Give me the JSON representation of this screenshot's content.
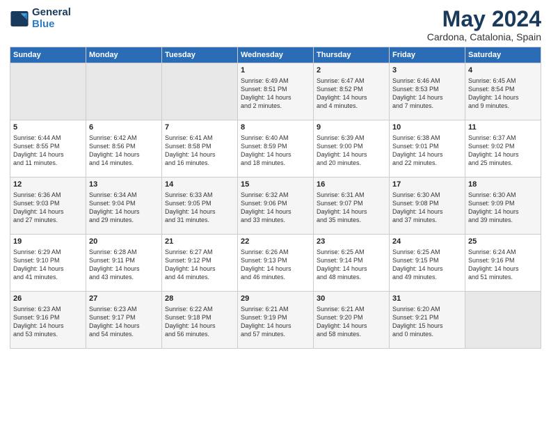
{
  "logo": {
    "line1": "General",
    "line2": "Blue"
  },
  "header": {
    "month_year": "May 2024",
    "location": "Cardona, Catalonia, Spain"
  },
  "weekdays": [
    "Sunday",
    "Monday",
    "Tuesday",
    "Wednesday",
    "Thursday",
    "Friday",
    "Saturday"
  ],
  "weeks": [
    [
      {
        "day": "",
        "content": ""
      },
      {
        "day": "",
        "content": ""
      },
      {
        "day": "",
        "content": ""
      },
      {
        "day": "1",
        "content": "Sunrise: 6:49 AM\nSunset: 8:51 PM\nDaylight: 14 hours\nand 2 minutes."
      },
      {
        "day": "2",
        "content": "Sunrise: 6:47 AM\nSunset: 8:52 PM\nDaylight: 14 hours\nand 4 minutes."
      },
      {
        "day": "3",
        "content": "Sunrise: 6:46 AM\nSunset: 8:53 PM\nDaylight: 14 hours\nand 7 minutes."
      },
      {
        "day": "4",
        "content": "Sunrise: 6:45 AM\nSunset: 8:54 PM\nDaylight: 14 hours\nand 9 minutes."
      }
    ],
    [
      {
        "day": "5",
        "content": "Sunrise: 6:44 AM\nSunset: 8:55 PM\nDaylight: 14 hours\nand 11 minutes."
      },
      {
        "day": "6",
        "content": "Sunrise: 6:42 AM\nSunset: 8:56 PM\nDaylight: 14 hours\nand 14 minutes."
      },
      {
        "day": "7",
        "content": "Sunrise: 6:41 AM\nSunset: 8:58 PM\nDaylight: 14 hours\nand 16 minutes."
      },
      {
        "day": "8",
        "content": "Sunrise: 6:40 AM\nSunset: 8:59 PM\nDaylight: 14 hours\nand 18 minutes."
      },
      {
        "day": "9",
        "content": "Sunrise: 6:39 AM\nSunset: 9:00 PM\nDaylight: 14 hours\nand 20 minutes."
      },
      {
        "day": "10",
        "content": "Sunrise: 6:38 AM\nSunset: 9:01 PM\nDaylight: 14 hours\nand 22 minutes."
      },
      {
        "day": "11",
        "content": "Sunrise: 6:37 AM\nSunset: 9:02 PM\nDaylight: 14 hours\nand 25 minutes."
      }
    ],
    [
      {
        "day": "12",
        "content": "Sunrise: 6:36 AM\nSunset: 9:03 PM\nDaylight: 14 hours\nand 27 minutes."
      },
      {
        "day": "13",
        "content": "Sunrise: 6:34 AM\nSunset: 9:04 PM\nDaylight: 14 hours\nand 29 minutes."
      },
      {
        "day": "14",
        "content": "Sunrise: 6:33 AM\nSunset: 9:05 PM\nDaylight: 14 hours\nand 31 minutes."
      },
      {
        "day": "15",
        "content": "Sunrise: 6:32 AM\nSunset: 9:06 PM\nDaylight: 14 hours\nand 33 minutes."
      },
      {
        "day": "16",
        "content": "Sunrise: 6:31 AM\nSunset: 9:07 PM\nDaylight: 14 hours\nand 35 minutes."
      },
      {
        "day": "17",
        "content": "Sunrise: 6:30 AM\nSunset: 9:08 PM\nDaylight: 14 hours\nand 37 minutes."
      },
      {
        "day": "18",
        "content": "Sunrise: 6:30 AM\nSunset: 9:09 PM\nDaylight: 14 hours\nand 39 minutes."
      }
    ],
    [
      {
        "day": "19",
        "content": "Sunrise: 6:29 AM\nSunset: 9:10 PM\nDaylight: 14 hours\nand 41 minutes."
      },
      {
        "day": "20",
        "content": "Sunrise: 6:28 AM\nSunset: 9:11 PM\nDaylight: 14 hours\nand 43 minutes."
      },
      {
        "day": "21",
        "content": "Sunrise: 6:27 AM\nSunset: 9:12 PM\nDaylight: 14 hours\nand 44 minutes."
      },
      {
        "day": "22",
        "content": "Sunrise: 6:26 AM\nSunset: 9:13 PM\nDaylight: 14 hours\nand 46 minutes."
      },
      {
        "day": "23",
        "content": "Sunrise: 6:25 AM\nSunset: 9:14 PM\nDaylight: 14 hours\nand 48 minutes."
      },
      {
        "day": "24",
        "content": "Sunrise: 6:25 AM\nSunset: 9:15 PM\nDaylight: 14 hours\nand 49 minutes."
      },
      {
        "day": "25",
        "content": "Sunrise: 6:24 AM\nSunset: 9:16 PM\nDaylight: 14 hours\nand 51 minutes."
      }
    ],
    [
      {
        "day": "26",
        "content": "Sunrise: 6:23 AM\nSunset: 9:16 PM\nDaylight: 14 hours\nand 53 minutes."
      },
      {
        "day": "27",
        "content": "Sunrise: 6:23 AM\nSunset: 9:17 PM\nDaylight: 14 hours\nand 54 minutes."
      },
      {
        "day": "28",
        "content": "Sunrise: 6:22 AM\nSunset: 9:18 PM\nDaylight: 14 hours\nand 56 minutes."
      },
      {
        "day": "29",
        "content": "Sunrise: 6:21 AM\nSunset: 9:19 PM\nDaylight: 14 hours\nand 57 minutes."
      },
      {
        "day": "30",
        "content": "Sunrise: 6:21 AM\nSunset: 9:20 PM\nDaylight: 14 hours\nand 58 minutes."
      },
      {
        "day": "31",
        "content": "Sunrise: 6:20 AM\nSunset: 9:21 PM\nDaylight: 15 hours\nand 0 minutes."
      },
      {
        "day": "",
        "content": ""
      }
    ]
  ]
}
